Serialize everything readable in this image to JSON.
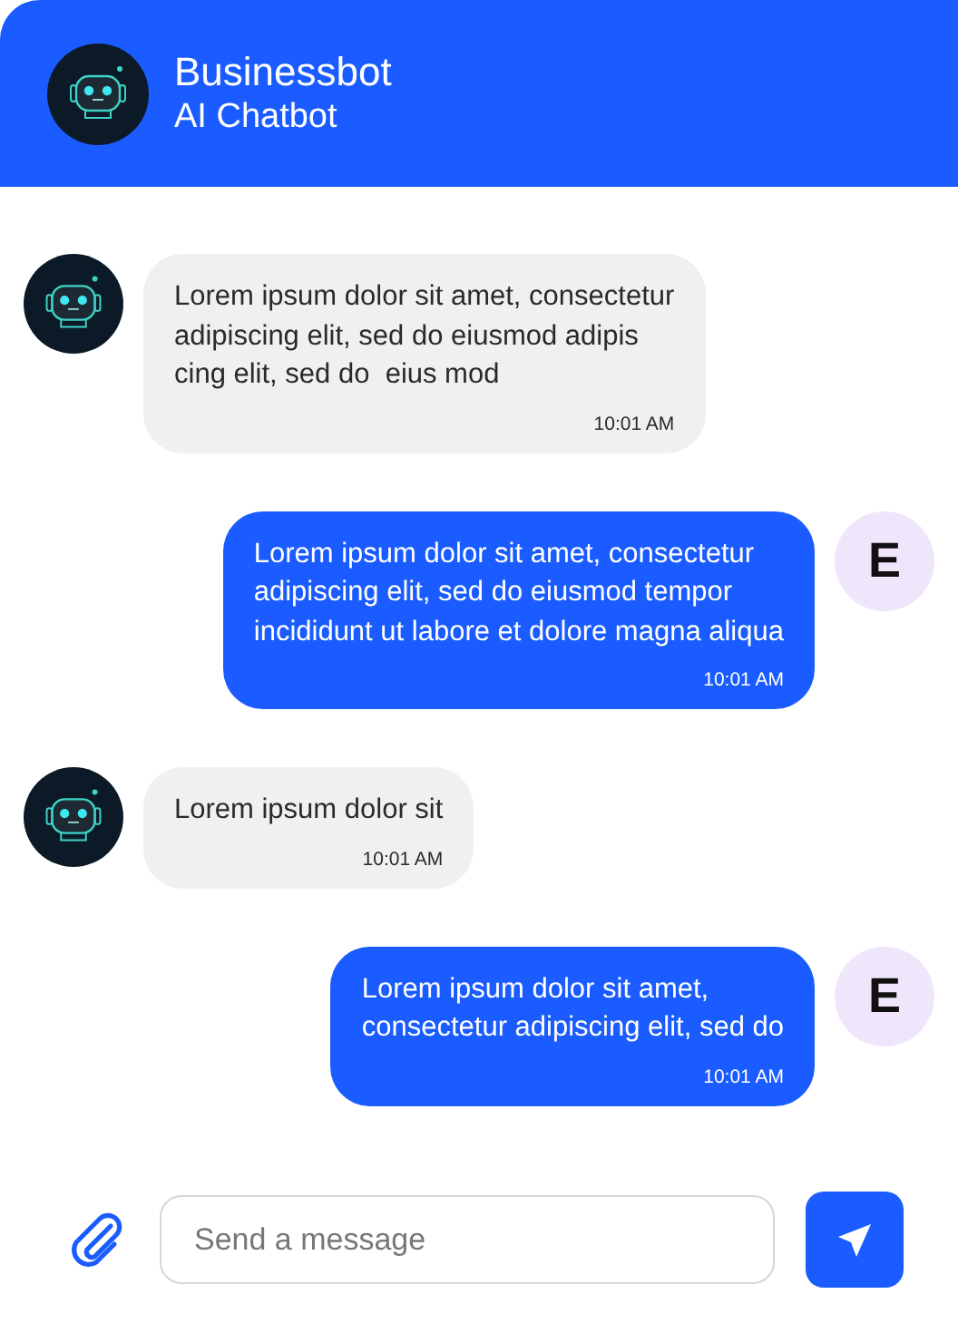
{
  "header": {
    "title": "Businessbot",
    "subtitle": "AI Chatbot"
  },
  "messages": [
    {
      "kind": "bot",
      "text": "Lorem ipsum dolor sit amet, consectetur\nadipiscing elit, sed do eiusmod adipis\ncing elit, sed do  eius mod",
      "time": "10:01 AM"
    },
    {
      "kind": "user",
      "avatar": "E",
      "text": "Lorem ipsum dolor sit amet, consectetur\nadipiscing elit, sed do eiusmod tempor\nincididunt ut labore et dolore magna aliqua",
      "time": "10:01 AM"
    },
    {
      "kind": "bot",
      "text": "Lorem ipsum dolor sit",
      "time": "10:01 AM"
    },
    {
      "kind": "user",
      "avatar": "E",
      "text": "Lorem ipsum dolor sit amet,\nconsectetur adipiscing elit, sed do",
      "time": "10:01 AM"
    }
  ],
  "composer": {
    "placeholder": "Send a message"
  }
}
